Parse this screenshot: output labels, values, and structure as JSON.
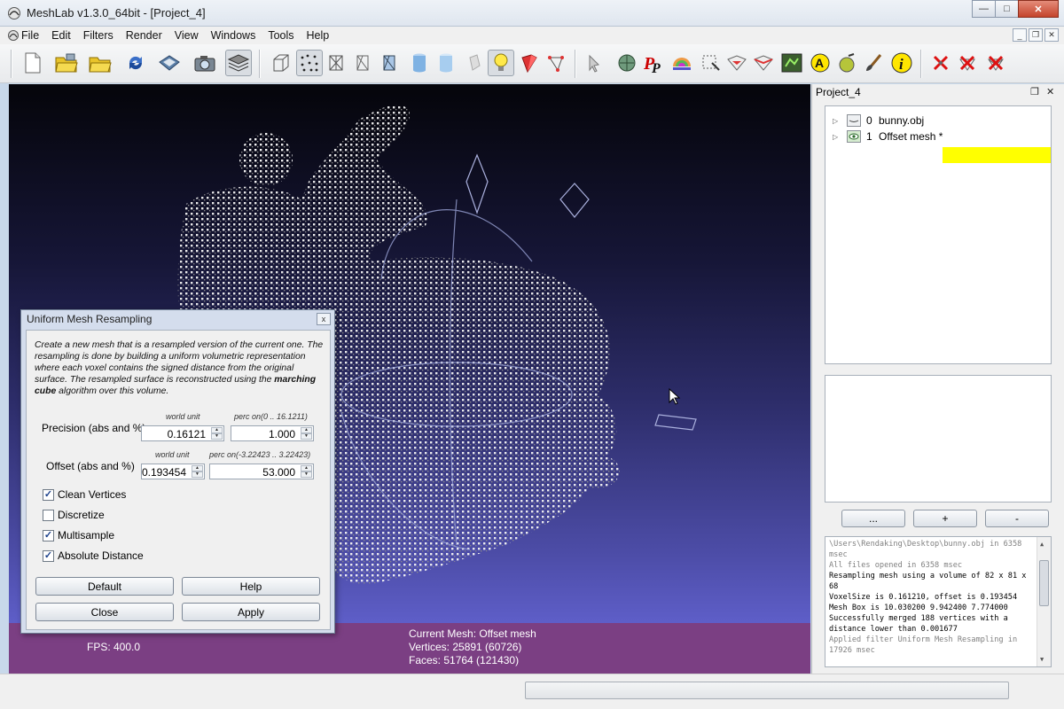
{
  "window": {
    "title": "MeshLab v1.3.0_64bit - [Project_4]",
    "controls": {
      "minimize": "—",
      "maximize": "□",
      "close": "✕"
    }
  },
  "menu": [
    "File",
    "Edit",
    "Filters",
    "Render",
    "View",
    "Windows",
    "Tools",
    "Help"
  ],
  "toolbar": {
    "icons": [
      "new-project",
      "open-project",
      "open-mesh",
      "reload",
      "save",
      "snapshot",
      "layers",
      "bbox",
      "points",
      "wireframe",
      "hidden-lines",
      "flat-lines",
      "flat",
      "smooth",
      "texture",
      "light",
      "backface",
      "selected-faces",
      "manipulator",
      "measure",
      "paint",
      "select-vertices",
      "select-faces",
      "select-connected",
      "align",
      "annotate",
      "pickpoints",
      "text",
      "brush",
      "info",
      "delete-vertices",
      "delete-faces",
      "delete-selection"
    ],
    "pressed": [
      "layers",
      "points",
      "light"
    ]
  },
  "viewport": {
    "info_left": [
      "FPS:   400.0"
    ],
    "info_right": [
      "Current Mesh: Offset mesh",
      "Vertices: 25891 (60726)",
      "Faces: 51764 (121430)"
    ]
  },
  "dock": {
    "title": "Project_4",
    "layers": [
      {
        "index": "0",
        "name": "bunny.obj",
        "visible": false,
        "selected": false
      },
      {
        "index": "1",
        "name": "Offset mesh *",
        "visible": true,
        "selected": true
      }
    ],
    "buttons": [
      "...",
      "+",
      "-"
    ],
    "log": [
      {
        "text": "\\Users\\Rendaking\\Desktop\\bunny.obj in 6358 msec",
        "style": "gray"
      },
      {
        "text": "All files opened in 6358 msec",
        "style": "gray"
      },
      {
        "text": "Resampling mesh using a volume of 82 x 81 x 68",
        "style": "dark"
      },
      {
        "text": "VoxelSize is 0.161210, offset is 0.193454",
        "style": "dark"
      },
      {
        "text": "Mesh Box is 10.030200 9.942400 7.774000",
        "style": "dark"
      },
      {
        "text": "Successfully merged 188 vertices with a distance lower than 0.001677",
        "style": "dark"
      },
      {
        "text": "Applied filter Uniform Mesh Resampling in 17926 msec",
        "style": "gray"
      }
    ]
  },
  "dialog": {
    "title": "Uniform Mesh Resampling",
    "close": "x",
    "desc_part1": "Create a new mesh that is a resampled version of the current one. The resampling is done by building a uniform volumetric representation where each voxel contains the signed distance from the original surface. The resampled surface is reconstructed using the ",
    "desc_bold": "marching cube",
    "desc_part2": " algorithm over this volume.",
    "precision": {
      "label": "Precision (abs and %)",
      "abs_caption": "world unit",
      "perc_caption": "perc on(0 .. 16.1211)",
      "abs_value": "0.16121",
      "perc_value": "1.000"
    },
    "offset": {
      "label": "Offset (abs and %)",
      "abs_caption": "world unit",
      "perc_caption": "perc on(-3.22423 .. 3.22423)",
      "abs_value": "0.193454",
      "perc_value": "53.000"
    },
    "checkboxes": [
      {
        "label": "Clean Vertices",
        "checked": true
      },
      {
        "label": "Discretize",
        "checked": false
      },
      {
        "label": "Multisample",
        "checked": true
      },
      {
        "label": "Absolute Distance",
        "checked": true
      }
    ],
    "buttons": {
      "default": "Default",
      "help": "Help",
      "close": "Close",
      "apply": "Apply"
    }
  },
  "colors": {
    "layer_highlight": "#ffff00",
    "info_bar": "#7b3f83"
  }
}
